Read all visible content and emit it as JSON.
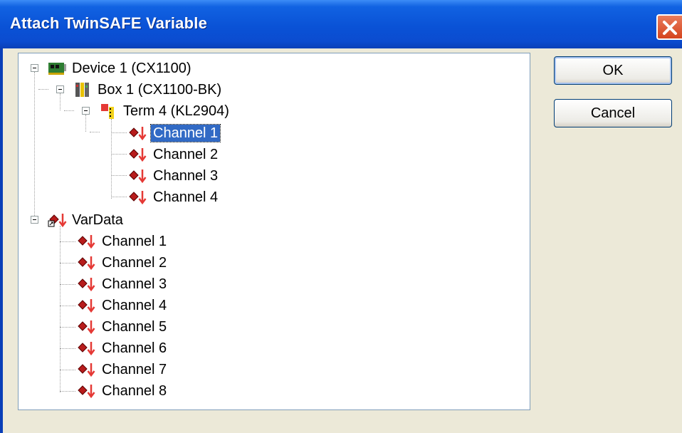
{
  "dialog": {
    "title": "Attach TwinSAFE Variable"
  },
  "buttons": {
    "ok": "OK",
    "cancel": "Cancel"
  },
  "tree": {
    "device": "Device 1 (CX1100)",
    "box": "Box 1 (CX1100-BK)",
    "term": "Term 4 (KL2904)",
    "term_channels": [
      "Channel 1",
      "Channel 2",
      "Channel 3",
      "Channel 4"
    ],
    "vardata": "VarData",
    "vardata_channels": [
      "Channel 1",
      "Channel 2",
      "Channel 3",
      "Channel 4",
      "Channel 5",
      "Channel 6",
      "Channel 7",
      "Channel 8"
    ]
  },
  "icons": {
    "device": "pci-card-icon",
    "box": "bus-coupler-icon",
    "term": "terminal-icon",
    "channel": "output-variable-icon",
    "vardata": "linked-variable-icon"
  },
  "colors": {
    "titlebar": "#0A52D6",
    "selection": "#316AC5",
    "dialog_bg": "#ECE9D8"
  }
}
